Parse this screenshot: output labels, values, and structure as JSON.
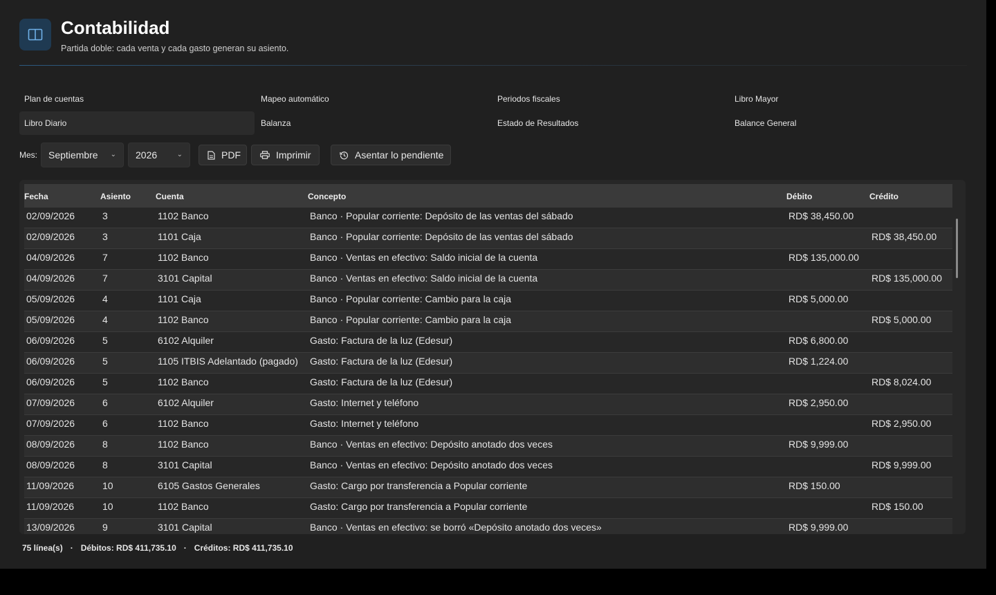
{
  "header": {
    "icon": "book-icon",
    "title": "Contabilidad",
    "subtitle": "Partida doble: cada venta y cada gasto generan su asiento."
  },
  "nav": {
    "items": [
      {
        "label": "Plan de cuentas",
        "selected": false
      },
      {
        "label": "Mapeo automático",
        "selected": false
      },
      {
        "label": "Periodos fiscales",
        "selected": false
      },
      {
        "label": "Libro Mayor",
        "selected": false
      },
      {
        "label": "Libro Diario",
        "selected": true
      },
      {
        "label": "Balanza",
        "selected": false
      },
      {
        "label": "Estado de Resultados",
        "selected": false
      },
      {
        "label": "Balance General",
        "selected": false
      }
    ]
  },
  "toolbar": {
    "mes_label": "Mes:",
    "month_value": "Septiembre",
    "year_value": "2026",
    "pdf_label": "PDF",
    "print_label": "Imprimir",
    "post_label": "Asentar lo pendiente"
  },
  "table": {
    "columns": {
      "fecha": "Fecha",
      "asiento": "Asiento",
      "cuenta": "Cuenta",
      "concepto": "Concepto",
      "debito": "Débito",
      "credito": "Crédito"
    },
    "rows": [
      {
        "fecha": "02/09/2026",
        "asiento": "3",
        "cuenta": "1102 Banco",
        "concepto": "Banco · Popular corriente: Depósito de las ventas del sábado",
        "debito": "RD$ 38,450.00",
        "credito": ""
      },
      {
        "fecha": "02/09/2026",
        "asiento": "3",
        "cuenta": "1101 Caja",
        "concepto": "Banco · Popular corriente: Depósito de las ventas del sábado",
        "debito": "",
        "credito": "RD$ 38,450.00"
      },
      {
        "fecha": "04/09/2026",
        "asiento": "7",
        "cuenta": "1102 Banco",
        "concepto": "Banco · Ventas en efectivo: Saldo inicial de la cuenta",
        "debito": "RD$ 135,000.00",
        "credito": ""
      },
      {
        "fecha": "04/09/2026",
        "asiento": "7",
        "cuenta": "3101 Capital",
        "concepto": "Banco · Ventas en efectivo: Saldo inicial de la cuenta",
        "debito": "",
        "credito": "RD$ 135,000.00"
      },
      {
        "fecha": "05/09/2026",
        "asiento": "4",
        "cuenta": "1101 Caja",
        "concepto": "Banco · Popular corriente: Cambio para la caja",
        "debito": "RD$ 5,000.00",
        "credito": ""
      },
      {
        "fecha": "05/09/2026",
        "asiento": "4",
        "cuenta": "1102 Banco",
        "concepto": "Banco · Popular corriente: Cambio para la caja",
        "debito": "",
        "credito": "RD$ 5,000.00"
      },
      {
        "fecha": "06/09/2026",
        "asiento": "5",
        "cuenta": "6102 Alquiler",
        "concepto": "Gasto: Factura de la luz (Edesur)",
        "debito": "RD$ 6,800.00",
        "credito": ""
      },
      {
        "fecha": "06/09/2026",
        "asiento": "5",
        "cuenta": "1105 ITBIS Adelantado (pagado)",
        "concepto": "Gasto: Factura de la luz (Edesur)",
        "debito": "RD$ 1,224.00",
        "credito": ""
      },
      {
        "fecha": "06/09/2026",
        "asiento": "5",
        "cuenta": "1102 Banco",
        "concepto": "Gasto: Factura de la luz (Edesur)",
        "debito": "",
        "credito": "RD$ 8,024.00"
      },
      {
        "fecha": "07/09/2026",
        "asiento": "6",
        "cuenta": "6102 Alquiler",
        "concepto": "Gasto: Internet y teléfono",
        "debito": "RD$ 2,950.00",
        "credito": ""
      },
      {
        "fecha": "07/09/2026",
        "asiento": "6",
        "cuenta": "1102 Banco",
        "concepto": "Gasto: Internet y teléfono",
        "debito": "",
        "credito": "RD$ 2,950.00"
      },
      {
        "fecha": "08/09/2026",
        "asiento": "8",
        "cuenta": "1102 Banco",
        "concepto": "Banco · Ventas en efectivo: Depósito anotado dos veces",
        "debito": "RD$ 9,999.00",
        "credito": ""
      },
      {
        "fecha": "08/09/2026",
        "asiento": "8",
        "cuenta": "3101 Capital",
        "concepto": "Banco · Ventas en efectivo: Depósito anotado dos veces",
        "debito": "",
        "credito": "RD$ 9,999.00"
      },
      {
        "fecha": "11/09/2026",
        "asiento": "10",
        "cuenta": "6105 Gastos Generales",
        "concepto": "Gasto: Cargo por transferencia a Popular corriente",
        "debito": "RD$ 150.00",
        "credito": ""
      },
      {
        "fecha": "11/09/2026",
        "asiento": "10",
        "cuenta": "1102 Banco",
        "concepto": "Gasto: Cargo por transferencia a Popular corriente",
        "debito": "",
        "credito": "RD$ 150.00"
      },
      {
        "fecha": "13/09/2026",
        "asiento": "9",
        "cuenta": "3101 Capital",
        "concepto": "Banco · Ventas en efectivo: se borró «Depósito anotado dos veces»",
        "debito": "RD$ 9,999.00",
        "credito": ""
      }
    ]
  },
  "footer": {
    "lines": "75 línea(s)",
    "debits": "Débitos: RD$ 411,735.10",
    "credits": "Créditos: RD$ 411,735.10"
  }
}
